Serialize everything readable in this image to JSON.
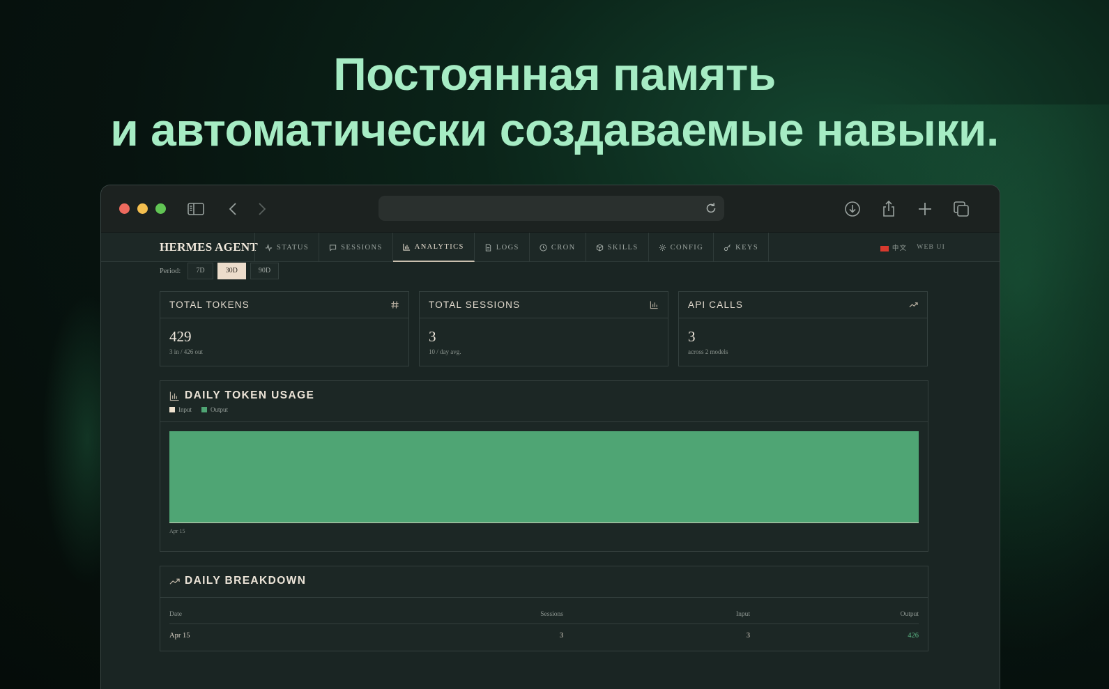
{
  "headline": {
    "line1": "Постоянная память",
    "line2": "и автоматически создаваемые навыки."
  },
  "browser": {
    "url": ""
  },
  "nav": {
    "brand": "HERMES AGENT",
    "tabs": [
      {
        "label": "STATUS",
        "icon": "activity-icon"
      },
      {
        "label": "SESSIONS",
        "icon": "chat-icon"
      },
      {
        "label": "ANALYTICS",
        "icon": "bar-chart-icon",
        "active": true
      },
      {
        "label": "LOGS",
        "icon": "file-icon"
      },
      {
        "label": "CRON",
        "icon": "clock-icon"
      },
      {
        "label": "SKILLS",
        "icon": "package-icon"
      },
      {
        "label": "CONFIG",
        "icon": "gear-icon"
      },
      {
        "label": "KEYS",
        "icon": "key-icon"
      }
    ],
    "language": "中文",
    "web_ui": "WEB UI"
  },
  "period": {
    "label": "Period:",
    "options": [
      "7D",
      "30D",
      "90D"
    ],
    "selected": "30D"
  },
  "cards": [
    {
      "title": "TOTAL TOKENS",
      "value": "429",
      "sub": "3 in / 426 out",
      "icon": "hash-icon"
    },
    {
      "title": "TOTAL SESSIONS",
      "value": "3",
      "sub": "10 / day avg.",
      "icon": "bar-chart-icon"
    },
    {
      "title": "API CALLS",
      "value": "3",
      "sub": "across 2 models",
      "icon": "trending-up-icon"
    }
  ],
  "daily_usage": {
    "title": "DAILY TOKEN USAGE",
    "legend": [
      {
        "name": "Input",
        "color": "#efe2cf"
      },
      {
        "name": "Output",
        "color": "#4fa574"
      }
    ]
  },
  "chart_data": {
    "type": "bar",
    "categories": [
      "Apr 15"
    ],
    "series": [
      {
        "name": "Input",
        "values": [
          3
        ],
        "color": "#efe2cf"
      },
      {
        "name": "Output",
        "values": [
          426
        ],
        "color": "#4fa574"
      }
    ],
    "stacked": true,
    "ylim": [
      0,
      429
    ],
    "grid": false,
    "legend": "top-left"
  },
  "breakdown": {
    "title": "DAILY BREAKDOWN",
    "columns": [
      "Date",
      "Sessions",
      "Input",
      "Output"
    ],
    "rows": [
      {
        "date": "Apr 15",
        "sessions": "3",
        "input": "3",
        "output": "426"
      }
    ]
  },
  "colors": {
    "accent": "#a6ecc4",
    "active_button": "#ecdccb",
    "output_green": "#5cb886"
  }
}
